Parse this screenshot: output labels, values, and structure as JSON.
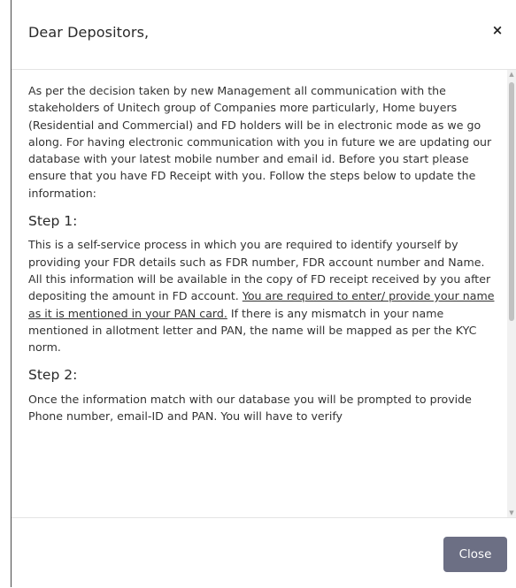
{
  "modal": {
    "title": "Dear Depositors,",
    "close_icon": "×",
    "intro": "As per the decision taken by new Management all communication with the stakeholders of Unitech group of Companies more particularly, Home buyers (Residential and Commercial) and FD holders will be in electronic mode as we go along. For having electronic communication with you in future we are updating our database with your latest mobile number and email id. Before you start please ensure that you have FD Receipt with you. Follow the steps below to update the information:",
    "steps": [
      {
        "heading": "Step 1:",
        "text_before": "This is a self-service process in which you are required to identify yourself by providing your FDR details such as FDR number, FDR account number and Name. All this information will be available in the copy of FD receipt received by you after depositing the amount in FD account. ",
        "text_underlined": "You are required to enter/ provide your name as it is mentioned in your PAN card.",
        "text_after": " If there is any mismatch in your name mentioned in allotment letter and PAN, the name will be mapped as per the KYC norm."
      },
      {
        "heading": "Step 2:",
        "text": "Once the information match with our database you will be prompted to provide Phone number, email-ID and PAN. You will have to verify"
      }
    ],
    "footer": {
      "close_label": "Close"
    },
    "scrollbar": {
      "up_icon": "▲",
      "down_icon": "▼"
    }
  },
  "colors": {
    "close_button_bg": "#6c6f84",
    "text": "#333333",
    "border": "#e4e4e4"
  }
}
